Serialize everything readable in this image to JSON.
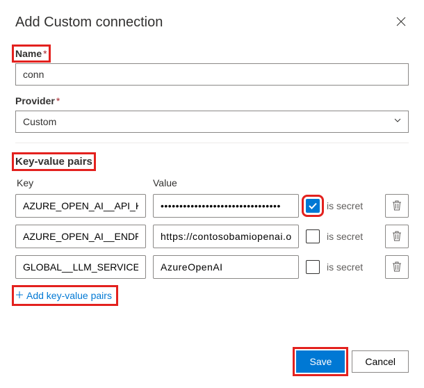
{
  "dialog": {
    "title": "Add Custom connection"
  },
  "fields": {
    "name_label": "Name",
    "name_value": "conn",
    "provider_label": "Provider",
    "provider_value": "Custom"
  },
  "kv": {
    "section_label": "Key-value pairs",
    "key_header": "Key",
    "value_header": "Value",
    "secret_label": "is secret",
    "add_label": "Add key-value pairs",
    "rows": [
      {
        "key": "AZURE_OPEN_AI__API_KEY",
        "value": "••••••••••••••••••••••••••••••••",
        "is_secret": true
      },
      {
        "key": "AZURE_OPEN_AI__ENDPOINT",
        "value": "https://contosobamiopenai.ope",
        "is_secret": false
      },
      {
        "key": "GLOBAL__LLM_SERVICE",
        "value": "AzureOpenAI",
        "is_secret": false
      }
    ]
  },
  "footer": {
    "save_label": "Save",
    "cancel_label": "Cancel"
  }
}
